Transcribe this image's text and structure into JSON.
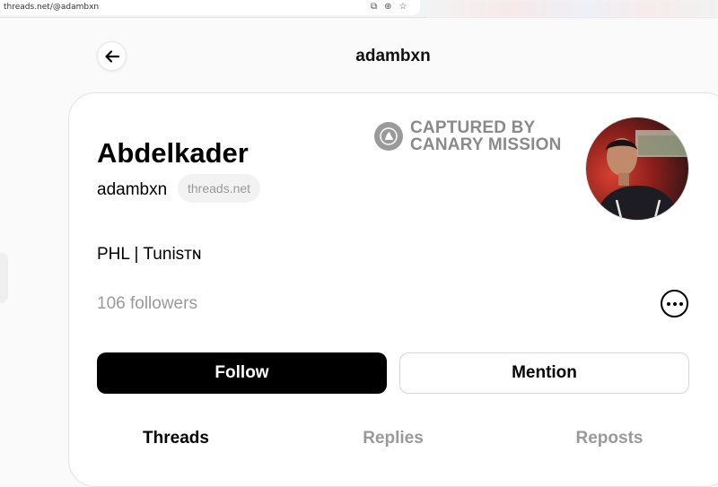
{
  "browser": {
    "url": "threads.net/@adambxn",
    "icons": [
      "open-in-app-icon",
      "zoom-icon",
      "star-icon"
    ]
  },
  "header": {
    "title": "adambxn",
    "back_icon": "arrow-left-icon"
  },
  "watermark": {
    "line1": "CAPTURED BY",
    "line2": "CANARY MISSION"
  },
  "profile": {
    "display_name": "Abdelkader",
    "username": "adambxn",
    "domain_chip": "threads.net",
    "bio": "PHL | Tunisᴛɴ",
    "followers": "106 followers"
  },
  "actions": {
    "follow_label": "Follow",
    "mention_label": "Mention",
    "more_icon": "more-horizontal-icon"
  },
  "tabs": [
    {
      "label": "Threads",
      "active": true
    },
    {
      "label": "Replies",
      "active": false
    },
    {
      "label": "Reposts",
      "active": false
    }
  ],
  "colors": {
    "primary": "#000000",
    "muted": "#999999",
    "watermark": "#8a8a8a"
  }
}
